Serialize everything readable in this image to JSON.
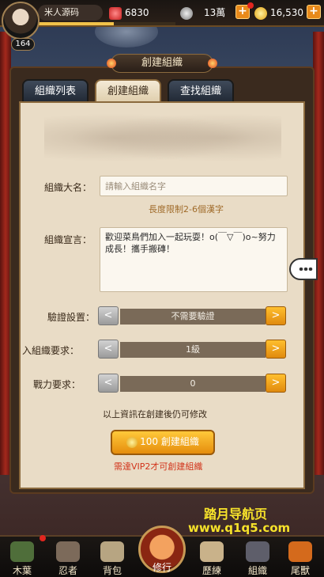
{
  "player": {
    "name": "米人源码",
    "level": "164",
    "xp_fraction": 0.55
  },
  "resources": {
    "stamina": "6830",
    "silver": "13萬",
    "gold": "16,530"
  },
  "window": {
    "title": "創建組織"
  },
  "tabs": [
    "組織列表",
    "創建組織",
    "查找組織"
  ],
  "active_tab": 1,
  "form": {
    "name_label": "組織大名：",
    "name_placeholder": "請輸入組織名字",
    "name_hint": "長度限制2-6個漢字",
    "declaration_label": "組織宣言：",
    "declaration_text": "歡迎菜鳥們加入一起玩耍！o(￣▽￣)o~努力成長！攜手搬磚！",
    "verification": {
      "label": "驗證設置：",
      "value": "不需要驗證"
    },
    "level_req": {
      "label": "入組織要求：",
      "value": "1級"
    },
    "power_req": {
      "label": "戰力要求：",
      "value": "0"
    },
    "modify_note": "以上資訊在創建後仍可修改",
    "create_button": {
      "cost": "100",
      "label": "創建組織"
    },
    "vip_note": "需達VIP2才可創建組織",
    "arrow_left": "<",
    "arrow_right": ">"
  },
  "bottom_nav": [
    {
      "label": "木葉",
      "icon": "village-icon"
    },
    {
      "label": "忍者",
      "icon": "ninja-icon"
    },
    {
      "label": "背包",
      "icon": "bag-icon"
    },
    {
      "label": "修行",
      "icon": "training-icon"
    },
    {
      "label": "歷練",
      "icon": "scroll-icon"
    },
    {
      "label": "組織",
      "icon": "organization-icon"
    },
    {
      "label": "尾獸",
      "icon": "tailed-beast-icon"
    }
  ],
  "watermark": {
    "line1": "踏月导航页",
    "line2": "www.q1q5.com"
  },
  "colors": {
    "accent_orange": "#e88a1b",
    "hint_brown": "#a06b2a",
    "vip_red": "#d2331a",
    "watermark_yellow": "#f6e22a"
  }
}
